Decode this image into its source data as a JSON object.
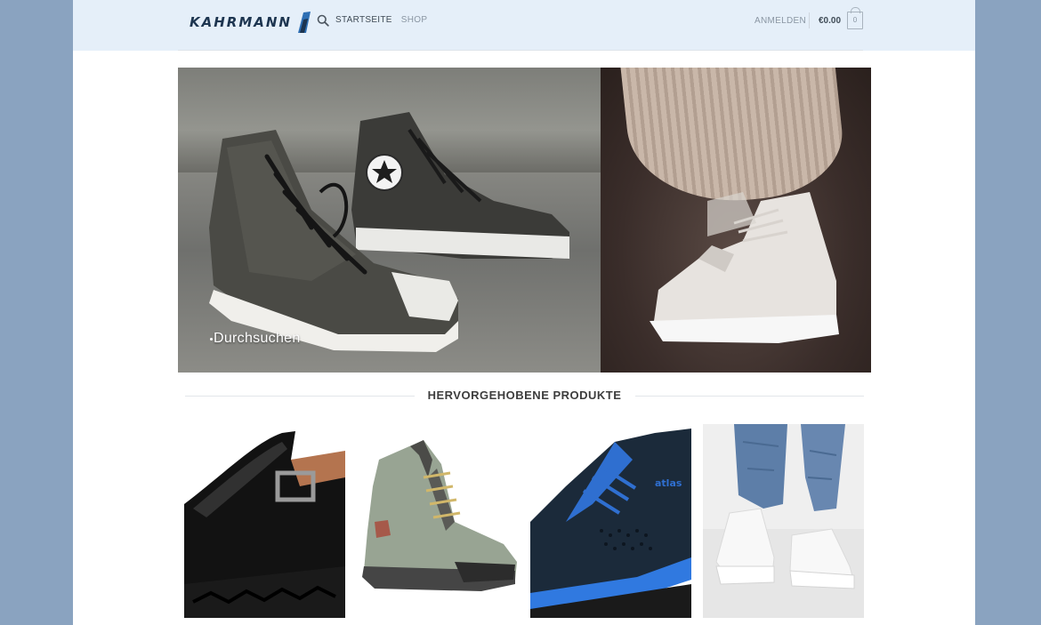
{
  "brand": {
    "name": "KAHRMANN"
  },
  "nav": {
    "items": [
      {
        "label": "STARTSEITE",
        "active": true
      },
      {
        "label": "SHOP",
        "active": false
      }
    ]
  },
  "header": {
    "account_label": "ANMELDEN",
    "cart_total": "€0.00",
    "cart_count": "0"
  },
  "hero": {
    "caption": "Durchsuchen"
  },
  "featured": {
    "title": "HERVORGEHOBENE PRODUKTE",
    "products": [
      {
        "icon": "black-mary-jane-shoe"
      },
      {
        "icon": "hiking-boot"
      },
      {
        "icon": "atlas-safety-sneaker",
        "brand_print": "atlas"
      },
      {
        "icon": "white-chunky-sneakers"
      }
    ]
  },
  "colors": {
    "background": "#8aa3c0",
    "header_bg": "#e5eff9",
    "text_dark": "#3d3d3d",
    "logo_navy": "#1d3550",
    "logo_blue": "#2e6fb4"
  }
}
